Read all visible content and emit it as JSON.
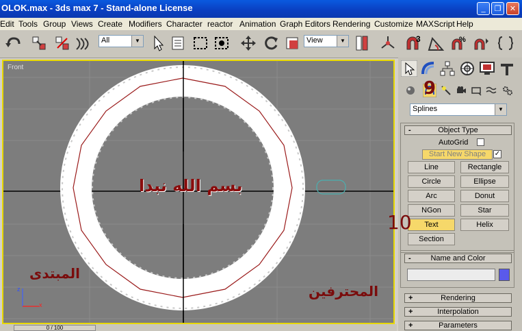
{
  "window": {
    "title": "OLOK.max - 3ds max 7  - Stand-alone License",
    "minimize": "_",
    "maximize": "❐",
    "close": "✕"
  },
  "menu": [
    "Edit",
    "Tools",
    "Group",
    "Views",
    "Create",
    "Modifiers",
    "Character",
    "reactor",
    "Animation",
    "Graph Editors",
    "Rendering",
    "Customize",
    "MAXScript",
    "Help"
  ],
  "toolbar": {
    "selection_filter": "All",
    "ref_coord": "View",
    "snap_label": "3"
  },
  "viewport": {
    "label": "Front",
    "text_center": "بسم الله نبدا",
    "text_left": "المبتدى",
    "text_right": "المحترفين",
    "axis_z": "z",
    "axis_x": "x"
  },
  "annotations": {
    "step9": "9",
    "step10": "10"
  },
  "command_panel": {
    "category": "Splines",
    "object_type_title": "Object Type",
    "autogrid": "AutoGrid",
    "start_new_shape": "Start New Shape",
    "check_mark": "✓",
    "buttons": [
      "Line",
      "Rectangle",
      "Circle",
      "Ellipse",
      "Arc",
      "Donut",
      "NGon",
      "Star",
      "Text",
      "Helix",
      "Section"
    ],
    "active_button": "Text",
    "name_color_title": "Name and Color",
    "swatch_color": "#5a5aea",
    "rollouts": [
      "Rendering",
      "Interpolation",
      "Parameters"
    ],
    "minus": "-",
    "plus": "+"
  },
  "statusbar": {
    "frame": "0 / 100"
  }
}
